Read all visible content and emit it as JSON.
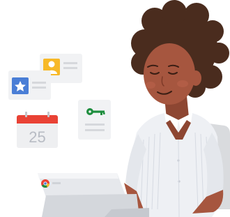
{
  "illustration": {
    "calendar": {
      "day": "25"
    },
    "icons": [
      "star-icon",
      "contact-card-icon",
      "key-icon",
      "calendar-icon",
      "chrome-icon"
    ],
    "colors": {
      "star_card": "#4a7ed6",
      "contact_card": "#f7b928",
      "key": "#1e8e3e",
      "calendar_header": "#e94235",
      "skin": "#a6563f",
      "hair": "#4a2c1e",
      "shirt": "#eef0f4",
      "laptop": "#e6e8ec",
      "chair": "#d9dbde"
    }
  }
}
